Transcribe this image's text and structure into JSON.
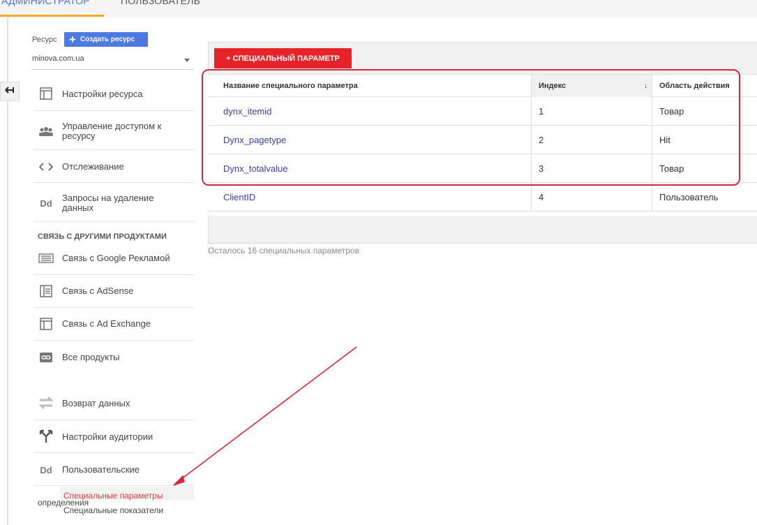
{
  "tabs": [
    {
      "label": "АДМИНИСТРАТОР",
      "active": true
    },
    {
      "label": "ПОЛЬЗОВАТЕЛЬ",
      "active": false
    }
  ],
  "resource": {
    "label": "Ресурс",
    "create_button": "Создать ресурс",
    "selected": "minova.com.ua"
  },
  "nav": {
    "items": [
      {
        "label": "Настройки ресурса",
        "icon": "window-icon"
      },
      {
        "label": "Управление доступом к ресурсу",
        "icon": "people-icon"
      },
      {
        "label": "Отслеживание",
        "icon": "code-icon"
      },
      {
        "label": "Запросы на удаление данных",
        "icon": "dd-icon"
      }
    ],
    "section_header": "СВЯЗЬ С ДРУГИМИ ПРОДУКТАМИ",
    "links": [
      {
        "label": "Связь с Google Рекламой",
        "icon": "google-ads-icon"
      },
      {
        "label": "Связь с AdSense",
        "icon": "adsense-icon"
      },
      {
        "label": "Связь с Ad Exchange",
        "icon": "ad-exchange-icon"
      },
      {
        "label": "Все продукты",
        "icon": "link-icon"
      }
    ],
    "more": [
      {
        "label": "Возврат данных",
        "icon": "data-return-icon"
      },
      {
        "label": "Настройки аудитории",
        "icon": "audience-fork-icon"
      },
      {
        "label": "Пользовательские",
        "icon": "dd-icon"
      }
    ],
    "custom_defs_suffix": "определения",
    "sub_items": [
      {
        "label": "Специальные параметры",
        "active": true
      },
      {
        "label": "Специальные показатели",
        "active": false
      }
    ]
  },
  "main": {
    "add_button": "+ СПЕЦИАЛЬНЫЙ ПАРАМЕТР",
    "columns": [
      "Название специального параметра",
      "Индекс",
      "Область действия"
    ],
    "sort_indicator": "↓",
    "rows": [
      {
        "name": "dynx_itemid",
        "index": "1",
        "scope": "Товар"
      },
      {
        "name": "Dynx_pagetype",
        "index": "2",
        "scope": "Hit"
      },
      {
        "name": "Dynx_totalvalue",
        "index": "3",
        "scope": "Товар"
      },
      {
        "name": "ClientID",
        "index": "4",
        "scope": "Пользователь"
      }
    ],
    "remaining": "Осталось 16 специальных параметров"
  },
  "colors": {
    "accent_red": "#e52329",
    "annotation_red": "#d9263a",
    "link_blue": "#3b3ba6",
    "create_button_blue": "#4d79e0",
    "tab_underline": "#f9a825"
  }
}
